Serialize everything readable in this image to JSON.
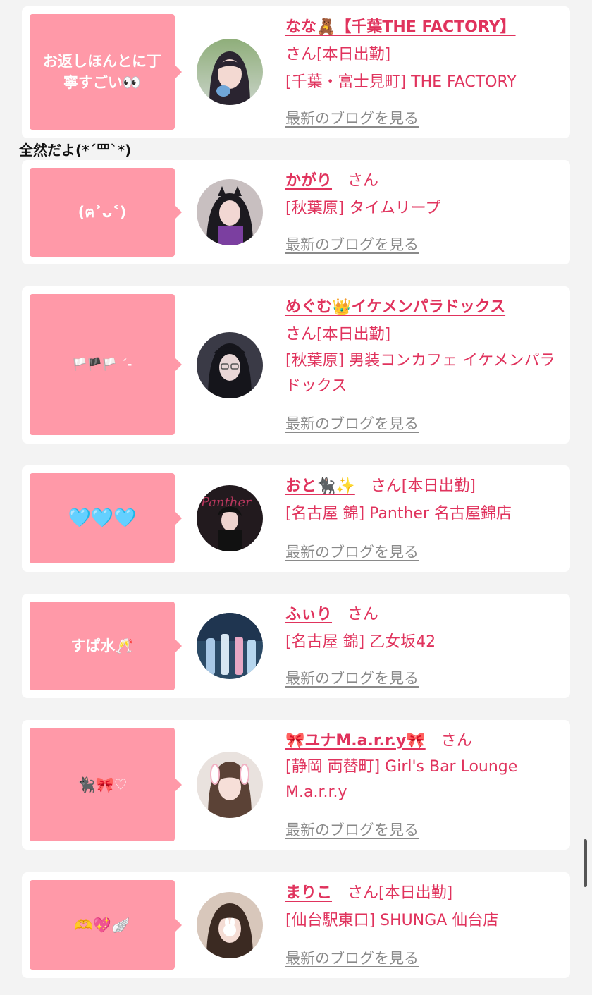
{
  "colors": {
    "page_background": "#f3f3f3",
    "card_background": "#ffffff",
    "bubble": "#ff99a8",
    "accent_text": "#e0335d",
    "muted_link": "#8a8a8a"
  },
  "floating_caption": "全然だよ(*´罒`*)",
  "cards": [
    {
      "bubble_text": "お返しほんとに丁\n寧すごい👀",
      "name": "なな🧸【千葉THE FACTORY】",
      "suffix": "さん[本日出勤]",
      "shop": "[千葉・富士見町] THE FACTORY",
      "blog_link": "最新のブログを見る",
      "avatar_icon": "avatar-portrait"
    },
    {
      "bubble_text": "(ฅ˃ᴗ˂)",
      "name": "かがり",
      "suffix": "さん",
      "shop": "[秋葉原] タイムリープ",
      "blog_link": "最新のブログを見る",
      "avatar_icon": "avatar-portrait"
    },
    {
      "bubble_text": "🏳️🏴🏳️ ´-",
      "name": "めぐむ👑イケメンパラドックス",
      "suffix": "さん[本日出勤]",
      "shop": "[秋葉原] 男装コンカフェ イケメンパラドックス",
      "blog_link": "最新のブログを見る",
      "avatar_icon": "avatar-portrait"
    },
    {
      "bubble_text": "🩵🩵🩵",
      "name": "おと🐈‍⬛✨",
      "suffix": "さん[本日出勤]",
      "shop": "[名古屋 錦] Panther 名古屋錦店",
      "blog_link": "最新のブログを見る",
      "avatar_icon": "avatar-portrait"
    },
    {
      "bubble_text": "すぱ水🥂",
      "name": "ふぃり",
      "suffix": "さん",
      "shop": "[名古屋 錦] 乙女坂42",
      "blog_link": "最新のブログを見る",
      "avatar_icon": "avatar-portrait"
    },
    {
      "bubble_text": "🐈‍⬛🎀♡",
      "name": "🎀ユナM.a.r.r.y🎀",
      "suffix": "さん",
      "shop": "[静岡 両替町] Girl's Bar Lounge M.a.r.r.y",
      "blog_link": "最新のブログを見る",
      "avatar_icon": "avatar-portrait"
    },
    {
      "bubble_text": "🫶💖🪽",
      "name": "まりこ",
      "suffix": "さん[本日出勤]",
      "shop": "[仙台駅東口] SHUNGA 仙台店",
      "blog_link": "最新のブログを見る",
      "avatar_icon": "avatar-portrait"
    }
  ]
}
